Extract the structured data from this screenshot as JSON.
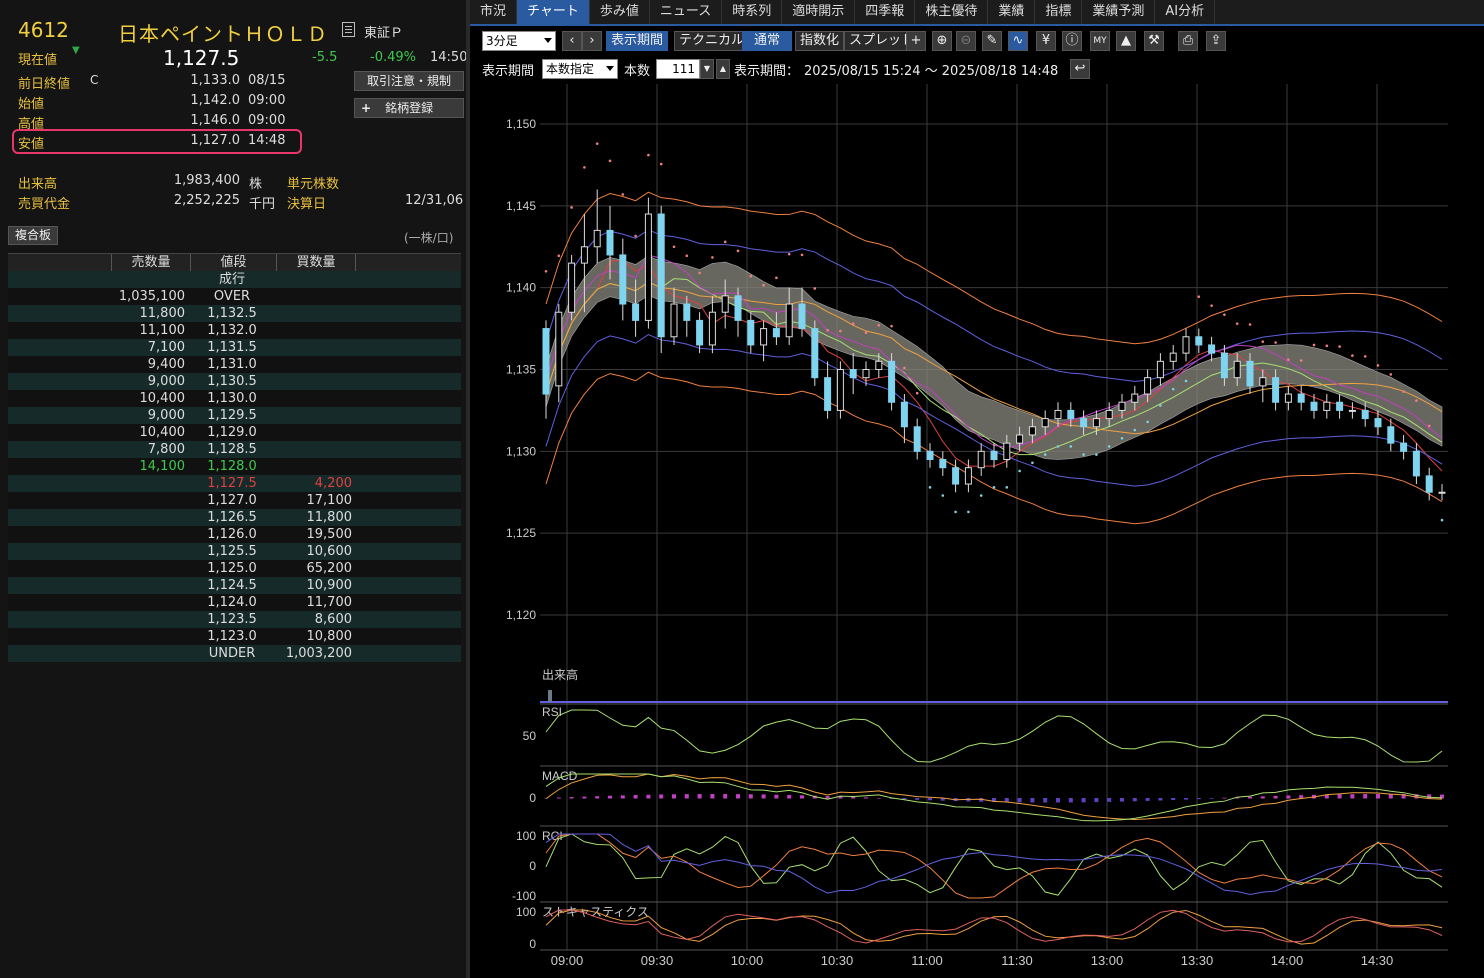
{
  "stock": {
    "code": "4612",
    "name": "日本ペイントＨＯＬＤ",
    "market": "東証Ｐ",
    "current_label": "現在値",
    "current_price": "1,127.5",
    "change": "-5.5",
    "change_pct": "-0.49%",
    "current_time": "14:50"
  },
  "buttons": {
    "rules": "取引注意・規制",
    "register": "銘柄登録",
    "register_icon": "+",
    "board": "複合板"
  },
  "quote": [
    {
      "label": "前日終値",
      "flag": "C",
      "value": "1,133.0",
      "time": "08/15"
    },
    {
      "label": "始値",
      "flag": "",
      "value": "1,142.0",
      "time": "09:00"
    },
    {
      "label": "高値",
      "flag": "",
      "value": "1,146.0",
      "time": "09:00"
    },
    {
      "label": "安値",
      "flag": "",
      "value": "1,127.0",
      "time": "14:48"
    }
  ],
  "volume": {
    "vol_label": "出来高",
    "vol_value": "1,983,400",
    "vol_unit": "株",
    "unit_label": "単元株数",
    "amt_label": "売買代金",
    "amt_value": "2,252,225",
    "amt_unit": "千円",
    "settle_label": "決算日",
    "settle_value": "12/31,06"
  },
  "board": {
    "unit_note": "(一株/口)",
    "headers": [
      "売数量",
      "値段",
      "買数量"
    ],
    "rows": [
      {
        "sell": "",
        "price": "成行",
        "buy": ""
      },
      {
        "sell": "1,035,100",
        "price": "OVER",
        "buy": ""
      },
      {
        "sell": "11,800",
        "price": "1,132.5",
        "buy": ""
      },
      {
        "sell": "11,100",
        "price": "1,132.0",
        "buy": ""
      },
      {
        "sell": "7,100",
        "price": "1,131.5",
        "buy": ""
      },
      {
        "sell": "9,400",
        "price": "1,131.0",
        "buy": ""
      },
      {
        "sell": "9,000",
        "price": "1,130.5",
        "buy": ""
      },
      {
        "sell": "10,400",
        "price": "1,130.0",
        "buy": ""
      },
      {
        "sell": "9,000",
        "price": "1,129.5",
        "buy": ""
      },
      {
        "sell": "10,400",
        "price": "1,129.0",
        "buy": ""
      },
      {
        "sell": "7,800",
        "price": "1,128.5",
        "buy": ""
      },
      {
        "sell": "14,100",
        "price": "1,128.0",
        "buy": ""
      },
      {
        "sell": "",
        "price": "1,127.5",
        "buy": "4,200"
      },
      {
        "sell": "",
        "price": "1,127.0",
        "buy": "17,100"
      },
      {
        "sell": "",
        "price": "1,126.5",
        "buy": "11,800"
      },
      {
        "sell": "",
        "price": "1,126.0",
        "buy": "19,500"
      },
      {
        "sell": "",
        "price": "1,125.5",
        "buy": "10,600"
      },
      {
        "sell": "",
        "price": "1,125.0",
        "buy": "65,200"
      },
      {
        "sell": "",
        "price": "1,124.5",
        "buy": "10,900"
      },
      {
        "sell": "",
        "price": "1,124.0",
        "buy": "11,700"
      },
      {
        "sell": "",
        "price": "1,123.5",
        "buy": "8,600"
      },
      {
        "sell": "",
        "price": "1,123.0",
        "buy": "10,800"
      },
      {
        "sell": "",
        "price": "UNDER",
        "buy": "1,003,200"
      }
    ]
  },
  "tabs": [
    "市況",
    "チャート",
    "歩み値",
    "ニュース",
    "時系列",
    "適時開示",
    "四季報",
    "株主優待",
    "業績",
    "指標",
    "業績予測",
    "AI分析"
  ],
  "active_tab": 1,
  "toolbar": {
    "interval": "3分足",
    "display_period": "表示期間",
    "technical": "テクニカル",
    "normal": "通常",
    "index": "指数化",
    "spread": "スプレッド",
    "icons": [
      "plus-icon",
      "zoom-in-icon",
      "zoom-out-icon",
      "pen-icon",
      "chart-type-icon",
      "yen-icon",
      "info-icon",
      "my-indicator-icon",
      "area-chart-icon",
      "wrench-icon",
      "print-icon",
      "export-icon"
    ],
    "period_label": "表示期間",
    "period_mode": "本数指定",
    "count_label": "本数",
    "count_value": "111",
    "range_label": "表示期間：",
    "range_value": "2025/08/15 15:24 ～ 2025/08/18 14:48"
  },
  "colors": {
    "up_candle": "#7fd4f0",
    "down_candle": "#7fd4f0",
    "cloud": "#8a8a80",
    "sar": "#f08080",
    "sar_up": "#80d0e0",
    "accent_tab": "#2a5aa0",
    "highlight_box": "#e8366a",
    "green_text": "#40c850",
    "red_text": "#e04040"
  },
  "chart_data": {
    "type": "candlestick",
    "ylim": [
      1120,
      1150
    ],
    "yticks": [
      "1,150",
      "1,145",
      "1,140",
      "1,135",
      "1,130",
      "1,125",
      "1,120"
    ],
    "xticks": [
      "09:00",
      "09:30",
      "10:00",
      "10:30",
      "11:00",
      "11:30",
      "13:00",
      "13:30",
      "14:00",
      "14:30"
    ],
    "candles": [
      [
        1137.5,
        1138.0,
        1132.0,
        1133.5
      ],
      [
        1134.0,
        1139.0,
        1133.0,
        1138.5
      ],
      [
        1138.5,
        1142.0,
        1138.0,
        1141.5
      ],
      [
        1141.5,
        1144.5,
        1138.5,
        1142.5
      ],
      [
        1142.5,
        1146.0,
        1141.5,
        1143.5
      ],
      [
        1143.5,
        1145.0,
        1140.5,
        1142.0
      ],
      [
        1142.0,
        1143.0,
        1138.0,
        1139.0
      ],
      [
        1139.0,
        1140.5,
        1137.0,
        1138.0
      ],
      [
        1138.0,
        1145.5,
        1137.5,
        1144.5
      ],
      [
        1144.5,
        1145.0,
        1136.0,
        1137.0
      ],
      [
        1137.0,
        1140.0,
        1136.5,
        1139.0
      ],
      [
        1139.0,
        1139.5,
        1137.0,
        1138.0
      ],
      [
        1138.0,
        1138.5,
        1136.0,
        1136.5
      ],
      [
        1136.5,
        1139.5,
        1136.0,
        1138.5
      ],
      [
        1138.5,
        1140.5,
        1137.5,
        1139.5
      ],
      [
        1139.5,
        1140.0,
        1137.0,
        1138.0
      ],
      [
        1138.0,
        1138.5,
        1136.0,
        1136.5
      ],
      [
        1136.5,
        1138.0,
        1135.5,
        1137.5
      ],
      [
        1137.5,
        1138.5,
        1136.5,
        1137.0
      ],
      [
        1137.0,
        1140.0,
        1136.5,
        1139.0
      ],
      [
        1139.0,
        1140.0,
        1137.0,
        1137.5
      ],
      [
        1137.5,
        1138.0,
        1134.0,
        1134.5
      ],
      [
        1134.5,
        1135.5,
        1132.0,
        1132.5
      ],
      [
        1132.5,
        1135.5,
        1132.0,
        1135.0
      ],
      [
        1135.0,
        1136.0,
        1133.5,
        1134.5
      ],
      [
        1134.5,
        1135.5,
        1134.0,
        1135.0
      ],
      [
        1135.0,
        1136.0,
        1134.5,
        1135.5
      ],
      [
        1135.5,
        1136.0,
        1132.5,
        1133.0
      ],
      [
        1133.0,
        1133.5,
        1130.5,
        1131.5
      ],
      [
        1131.5,
        1132.0,
        1129.5,
        1130.0
      ],
      [
        1130.0,
        1130.5,
        1129.0,
        1129.5
      ],
      [
        1129.5,
        1130.0,
        1128.5,
        1129.0
      ],
      [
        1129.0,
        1129.5,
        1127.5,
        1128.0
      ],
      [
        1128.0,
        1129.5,
        1127.5,
        1129.0
      ],
      [
        1129.0,
        1130.5,
        1128.5,
        1130.0
      ],
      [
        1130.0,
        1130.5,
        1129.0,
        1129.5
      ],
      [
        1129.5,
        1131.0,
        1129.0,
        1130.5
      ],
      [
        1130.5,
        1131.5,
        1130.0,
        1131.0
      ],
      [
        1131.0,
        1132.0,
        1130.5,
        1131.5
      ],
      [
        1131.5,
        1132.5,
        1131.0,
        1132.0
      ],
      [
        1132.0,
        1133.0,
        1131.5,
        1132.5
      ],
      [
        1132.5,
        1133.0,
        1131.5,
        1132.0
      ],
      [
        1132.0,
        1132.5,
        1131.0,
        1131.5
      ],
      [
        1131.5,
        1132.5,
        1131.0,
        1132.0
      ],
      [
        1132.0,
        1133.0,
        1131.5,
        1132.5
      ],
      [
        1132.5,
        1133.5,
        1132.0,
        1133.0
      ],
      [
        1133.0,
        1134.0,
        1132.5,
        1133.5
      ],
      [
        1133.5,
        1135.0,
        1133.0,
        1134.5
      ],
      [
        1134.5,
        1136.0,
        1134.0,
        1135.5
      ],
      [
        1135.5,
        1136.5,
        1135.0,
        1136.0
      ],
      [
        1136.0,
        1137.5,
        1135.5,
        1137.0
      ],
      [
        1137.0,
        1137.5,
        1136.0,
        1136.5
      ],
      [
        1136.5,
        1137.0,
        1135.5,
        1136.0
      ],
      [
        1136.0,
        1136.5,
        1134.0,
        1134.5
      ],
      [
        1134.5,
        1136.0,
        1134.0,
        1135.5
      ],
      [
        1135.5,
        1136.0,
        1133.5,
        1134.0
      ],
      [
        1134.0,
        1135.0,
        1133.0,
        1134.5
      ],
      [
        1134.5,
        1135.0,
        1132.5,
        1133.0
      ],
      [
        1133.0,
        1134.0,
        1132.5,
        1133.5
      ],
      [
        1133.5,
        1134.0,
        1132.5,
        1133.0
      ],
      [
        1133.0,
        1133.5,
        1132.0,
        1132.5
      ],
      [
        1132.5,
        1133.5,
        1132.0,
        1133.0
      ],
      [
        1133.0,
        1133.5,
        1132.0,
        1132.5
      ],
      [
        1132.5,
        1133.0,
        1132.0,
        1132.5
      ],
      [
        1132.5,
        1133.0,
        1131.5,
        1132.0
      ],
      [
        1132.0,
        1132.5,
        1131.0,
        1131.5
      ],
      [
        1131.5,
        1132.0,
        1130.0,
        1130.5
      ],
      [
        1130.5,
        1131.0,
        1129.5,
        1130.0
      ],
      [
        1130.0,
        1130.5,
        1128.0,
        1128.5
      ],
      [
        1128.5,
        1129.0,
        1127.0,
        1127.5
      ],
      [
        1127.5,
        1128.0,
        1127.0,
        1127.5
      ]
    ],
    "subpanels": [
      {
        "name": "出来高",
        "ticks": []
      },
      {
        "name": "RSI",
        "ticks": [
          "50"
        ]
      },
      {
        "name": "MACD",
        "ticks": [
          "0"
        ]
      },
      {
        "name": "RCI",
        "ticks": [
          "100",
          "0",
          "-100"
        ]
      },
      {
        "name": "ストキャスティクス",
        "ticks": [
          "100",
          "0"
        ]
      }
    ]
  }
}
